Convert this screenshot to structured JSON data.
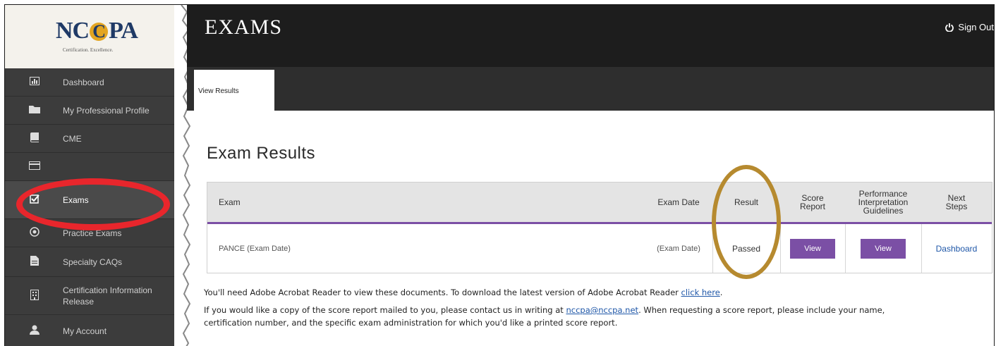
{
  "brand": {
    "logo_left": "NC",
    "logo_mid": "C",
    "logo_right": "PA",
    "tagline": "Certification.   Excellence."
  },
  "sidebar": {
    "items": [
      {
        "label": "Dashboard",
        "icon": "bar-chart-icon"
      },
      {
        "label": "My Professional Profile",
        "icon": "folder-icon"
      },
      {
        "label": "CME",
        "icon": "book-icon"
      },
      {
        "label": "",
        "icon": "credit-card-icon"
      },
      {
        "label": "Exams",
        "icon": "checkbox-icon"
      },
      {
        "label": "Practice Exams",
        "icon": "target-icon"
      },
      {
        "label": "Specialty CAQs",
        "icon": "document-icon"
      },
      {
        "label": "Certification Information Release",
        "icon": "building-icon"
      },
      {
        "label": "My Account",
        "icon": "user-icon"
      }
    ]
  },
  "header": {
    "title": "EXAMS",
    "signout": "Sign Out"
  },
  "tabs": [
    {
      "label": "View Results"
    }
  ],
  "main": {
    "heading": "Exam Results",
    "columns": [
      "Exam",
      "Exam Date",
      "Result",
      "Score\nReport",
      "Performance\nInterpretation\nGuidelines",
      "Next\nSteps"
    ],
    "rows": [
      {
        "exam": "PANCE (Exam Date)",
        "date": "(Exam Date)",
        "result": "Passed",
        "score": "View",
        "perf": "View",
        "next": "Dashboard"
      }
    ],
    "note1_pre": "You'll need Adobe Acrobat Reader to view these documents. To download the latest version of Adobe Acrobat Reader ",
    "note1_link": "click here",
    "note1_post": ".",
    "note2_pre": "If you would like a copy of the score report mailed to you, please contact us in writing at ",
    "note2_link": "nccpa@nccpa.net",
    "note2_post": ". When requesting a score report, please include your name,",
    "note3": "certification number, and the specific exam administration for which you'd like a printed score report."
  },
  "colors": {
    "accent": "#7b4fa5",
    "link": "#1f57a8",
    "highlight_red": "#e8262c",
    "highlight_gold": "#b68a2f"
  }
}
